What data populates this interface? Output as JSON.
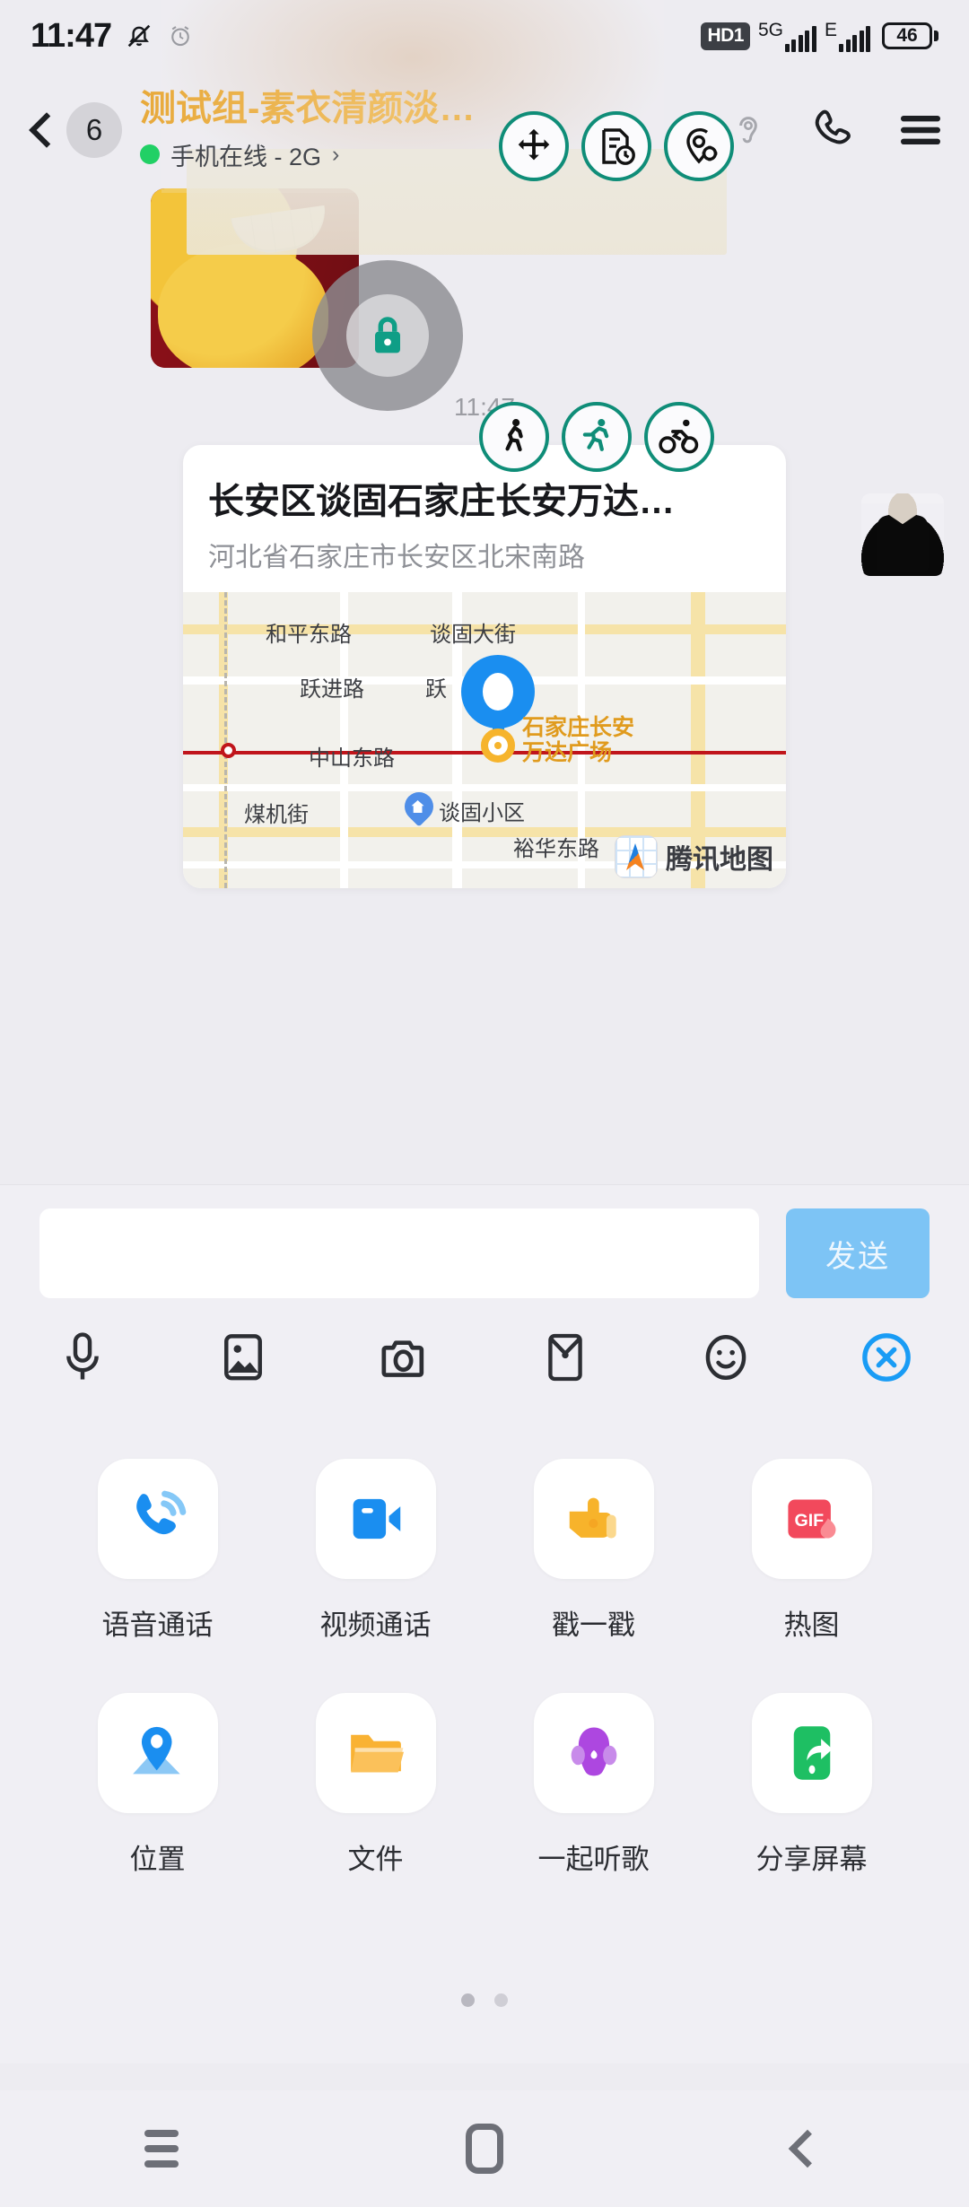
{
  "statusbar": {
    "time": "11:47",
    "mute_icon": "bell-muted-icon",
    "alarm_icon": "alarm-icon",
    "hd_label": "HD1",
    "net1_label": "5G",
    "net2_label": "E",
    "battery_level": "46"
  },
  "header": {
    "back_icon": "back-chevron-icon",
    "unread_count": "6",
    "title": "测试组-素衣清颜淡…",
    "status_text": "手机在线 - 2G",
    "status_arrow": "›",
    "online_color": "#21d065",
    "title_color": "#e8a93a",
    "call_icon": "phone-icon",
    "menu_icon": "hamburger-menu-icon",
    "ear_icon": "ear-icon"
  },
  "overlay": {
    "accent_color": "#0f8d78",
    "move_icon": "move-arrows-icon",
    "document_clock_icon": "document-clock-icon",
    "location_target_icon": "location-target-icon",
    "lock_icon": "lock-icon",
    "lock_color": "#0f9e86",
    "walk_icon": "walking-person-icon",
    "run_icon": "running-person-icon",
    "bike_icon": "cycling-person-icon"
  },
  "chat": {
    "image_message_timestamp": "11:47",
    "avatar": "suit-avatar",
    "location_card": {
      "title": "长安区谈固石家庄长安万达…",
      "subtitle": "河北省石家庄市长安区北宋南路",
      "map_labels": [
        "和平东路",
        "谈固大街",
        "跃进路",
        "跃",
        "中山东路",
        "煤机街",
        "谈固小区",
        "裕华东路"
      ],
      "poi_label_line1": "石家庄长安",
      "poi_label_line2": "万达广场",
      "map_provider": "腾讯地图",
      "pin_color": "#1a8ef0",
      "poi_color": "#e09b1e"
    }
  },
  "input": {
    "value": "",
    "placeholder": "",
    "send_label": "发送",
    "send_color": "#7dc4f5",
    "tools": [
      {
        "name": "microphone-icon"
      },
      {
        "name": "image-icon"
      },
      {
        "name": "camera-icon"
      },
      {
        "name": "red-packet-icon"
      },
      {
        "name": "emoji-icon"
      },
      {
        "name": "close-circle-icon"
      }
    ]
  },
  "panel": {
    "items": [
      {
        "label": "语音通话",
        "icon": "voice-call-icon",
        "color": "#1a8ef0"
      },
      {
        "label": "视频通话",
        "icon": "video-call-icon",
        "color": "#1a8ef0"
      },
      {
        "label": "戳一戳",
        "icon": "poke-hand-icon",
        "color": "#f7b32b"
      },
      {
        "label": "热图",
        "icon": "gif-hot-icon",
        "color": "#f2495c"
      },
      {
        "label": "位置",
        "icon": "location-map-icon",
        "color": "#1a8ef0"
      },
      {
        "label": "文件",
        "icon": "folder-icon",
        "color": "#f9b233"
      },
      {
        "label": "一起听歌",
        "icon": "earbuds-music-icon",
        "color": "#ad47e0"
      },
      {
        "label": "分享屏幕",
        "icon": "share-screen-icon",
        "color": "#1ebf63"
      }
    ],
    "page_dots": 2,
    "active_dot": 0
  },
  "navbar": {
    "recents_icon": "recents-menu-icon",
    "home_icon": "home-square-icon",
    "back_icon": "back-chevron-icon"
  }
}
